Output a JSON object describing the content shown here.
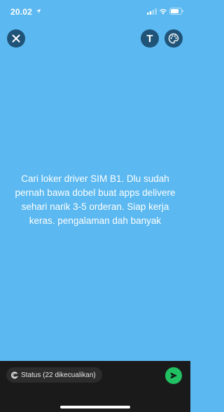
{
  "status_bar": {
    "time": "20.02",
    "icons": [
      "location-arrow-icon",
      "cellular-signal-icon",
      "wifi-icon",
      "battery-icon"
    ]
  },
  "toolbar": {
    "close_icon": "close-icon",
    "text_label": "T",
    "palette_icon": "palette-icon"
  },
  "message": {
    "text": "Cari loker driver SIM B1. Dlu sudah pernah bawa dobel buat apps delivere sehari narik 3-5 orderan. Siap kerja keras. pengalaman dah banyak"
  },
  "composer": {
    "privacy_label": "Status (22 dikecualikan)",
    "send_icon": "send-icon"
  },
  "colors": {
    "background": "#5bb8f0",
    "button_bg": "#1f5478",
    "bottom_bar": "#1a1a1a",
    "send": "#21c063"
  }
}
